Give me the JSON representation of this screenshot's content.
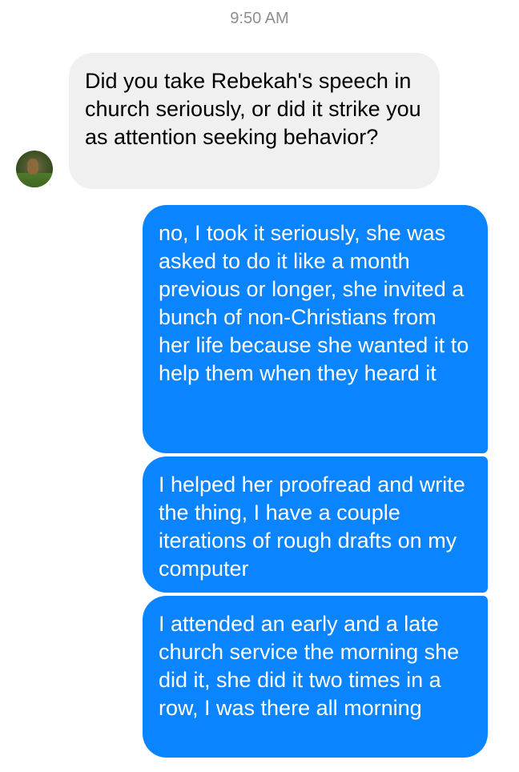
{
  "timestamp": "9:50 AM",
  "contact": {
    "avatar_icon": "contact-avatar"
  },
  "messages": [
    {
      "direction": "incoming",
      "text": "Did you take Rebekah's speech in church seriously, or did it strike you as attention seeking behavior?"
    },
    {
      "direction": "outgoing",
      "text": "no, I took it seriously, she was asked to do it like a month previous or longer, she invited a bunch of non-Christians from her life because she wanted it to help them when they heard it"
    },
    {
      "direction": "outgoing",
      "text": "I helped her proofread and write the thing, I have a couple iterations of rough drafts on my computer"
    },
    {
      "direction": "outgoing",
      "text": "I attended an early and a late church service the morning she did it, she did it two times in a row, I was there all morning"
    }
  ],
  "colors": {
    "outgoing_bubble": "#0a84ff",
    "incoming_bubble": "#f1f0f0",
    "timestamp": "#8e8e93"
  }
}
